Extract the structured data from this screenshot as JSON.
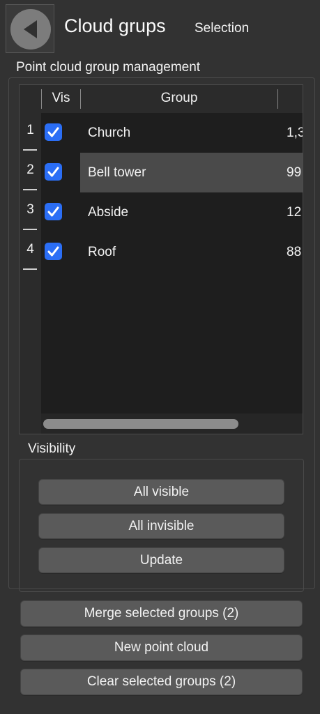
{
  "header": {
    "back_icon": "back-arrow-icon",
    "title": "Cloud grups",
    "subtitle": "Selection"
  },
  "group_management": {
    "label": "Point cloud group management",
    "table": {
      "columns": [
        "Vis",
        "Group",
        ""
      ],
      "rows": [
        {
          "num": "1",
          "visible": true,
          "group": "Church",
          "size": "1,3"
        },
        {
          "num": "2",
          "visible": true,
          "group": "Bell tower",
          "size": "99",
          "selected": true
        },
        {
          "num": "3",
          "visible": true,
          "group": "Abside",
          "size": "12"
        },
        {
          "num": "4",
          "visible": true,
          "group": "Roof",
          "size": "88"
        }
      ]
    }
  },
  "visibility": {
    "label": "Visibility",
    "all_visible": "All visible",
    "all_invisible": "All invisible",
    "update": "Update"
  },
  "actions": {
    "merge": "Merge selected groups (2)",
    "new_cloud": "New point cloud",
    "clear": "Clear selected groups (2)"
  },
  "colors": {
    "checkbox": "#2b6ef5",
    "selected_row": "#4a4a4a",
    "background": "#323232"
  }
}
